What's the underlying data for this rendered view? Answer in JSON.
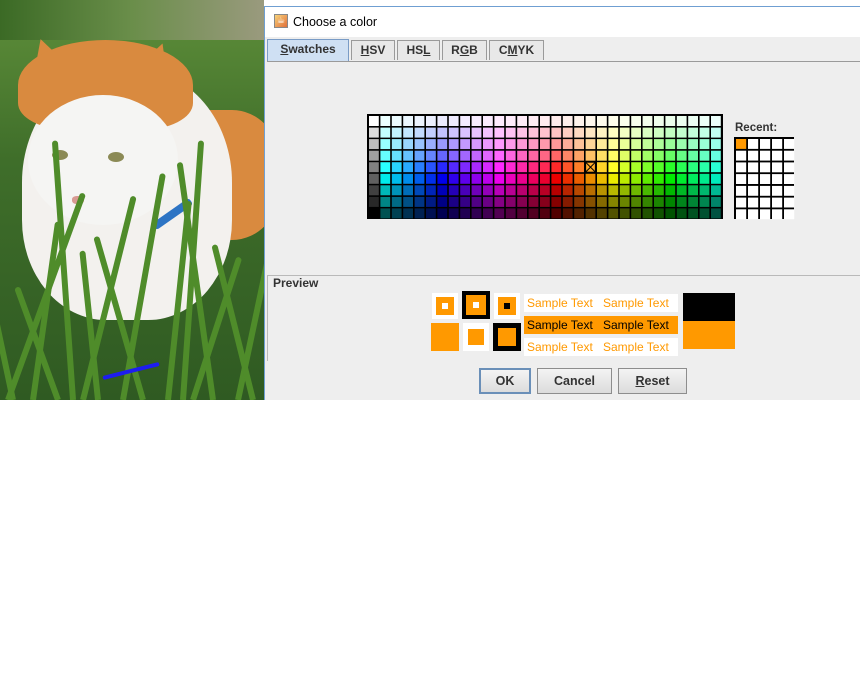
{
  "dialog": {
    "title": "Choose a color",
    "tabs": [
      {
        "label": "Swatches",
        "mnemonic": "S",
        "rest": "watches"
      },
      {
        "label": "HSV",
        "mnemonic": "H",
        "rest": "SV"
      },
      {
        "label": "HSL",
        "prefix": "HS",
        "mnemonic": "L"
      },
      {
        "label": "RGB",
        "prefix": "R",
        "mnemonic": "G",
        "suffix": "B"
      },
      {
        "label": "CMYK",
        "prefix": "C",
        "mnemonic": "M",
        "suffix": "YK"
      }
    ],
    "active_tab": "Swatches",
    "recent_label": "Recent:",
    "preview_label": "Preview",
    "sample_text": "Sample Text",
    "selected_color": "#ff9900",
    "buttons": {
      "ok": "OK",
      "cancel": "Cancel",
      "reset_mnemonic": "R",
      "reset_rest": "eset"
    }
  },
  "colors": {
    "accent": "#ff9900",
    "black": "#000000",
    "white": "#ffffff",
    "tab_active": "#cfe0f3",
    "sample_strip_bg": "#ff9900"
  }
}
